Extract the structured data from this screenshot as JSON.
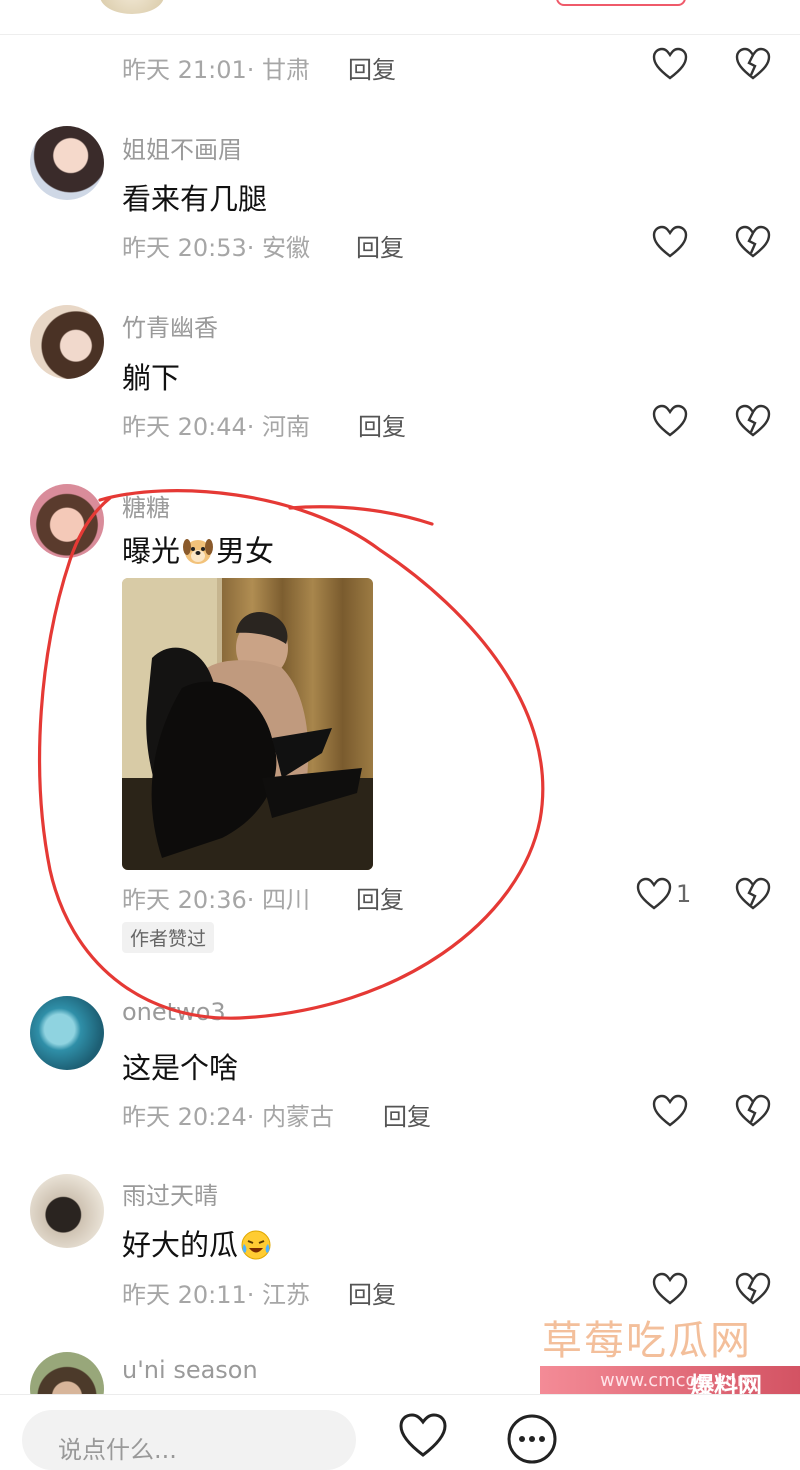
{
  "comments": [
    {
      "meta": "昨天 21:01· 甘肃",
      "reply": "回复"
    },
    {
      "username": "姐姐不画眉",
      "text": "看来有几腿",
      "meta": "昨天 20:53· 安徽",
      "reply": "回复"
    },
    {
      "username": "竹青幽香",
      "text": "躺下",
      "meta": "昨天 20:44· 河南",
      "reply": "回复"
    },
    {
      "username": "糖糖",
      "text_before": "曝光",
      "emoji": "dog-face-emoji",
      "text_after": "男女",
      "meta": "昨天 20:36· 四川",
      "reply": "回复",
      "like_count": "1",
      "tag": "作者赞过"
    },
    {
      "username": "onetwo3",
      "text": "这是个啥",
      "meta": "昨天 20:24· 内蒙古",
      "reply": "回复"
    },
    {
      "username": "雨过天晴",
      "text": "好大的瓜",
      "emoji": "crying-laughing-emoji",
      "meta": "昨天 20:11· 江苏",
      "reply": "回复"
    },
    {
      "username": "u'ni season"
    }
  ],
  "bottom_bar": {
    "input_placeholder": "说点什么..."
  },
  "watermark": {
    "site_name": "草莓吃瓜网",
    "url": "www.cmcgw.com",
    "label": "爆料网"
  },
  "colors": {
    "accent": "#ef5a6a",
    "annotation_circle": "#e53935",
    "meta_gray": "#a6a6a6"
  }
}
